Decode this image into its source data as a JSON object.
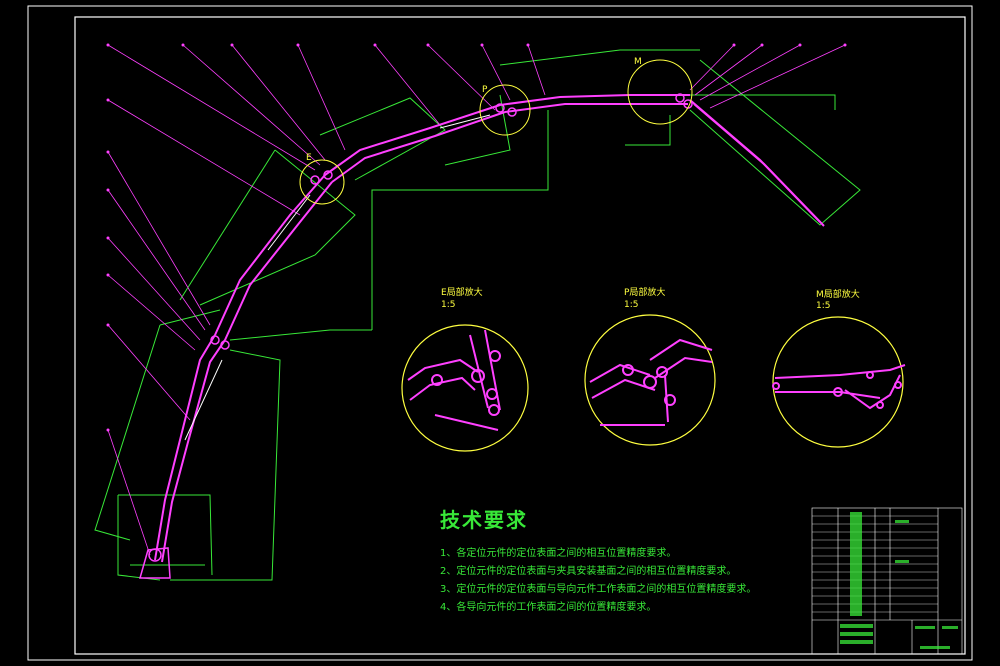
{
  "drawing": {
    "border_color": "#ffffff",
    "line_colors": {
      "frame": "#ffffff",
      "dimension": "#38e838",
      "arm": "#ff40ff",
      "detail_circle": "#ffff40",
      "leader": "#ff40ff"
    }
  },
  "detail_views": [
    {
      "letter": "E",
      "title": "E局部放大",
      "scale": "1:5"
    },
    {
      "letter": "P",
      "title": "P局部放大",
      "scale": "1:5"
    },
    {
      "letter": "M",
      "title": "M局部放大",
      "scale": "1:5"
    }
  ],
  "view_markers": {
    "e_marker": "E",
    "p_marker": "P",
    "m_marker": "M"
  },
  "tech_requirements": {
    "title": "技术要求",
    "items": [
      "1、各定位元件的定位表面之间的相互位置精度要求。",
      "2、定位元件的定位表面与夹具安装基面之间的相互位置精度要求。",
      "3、定位元件的定位表面与导向元件工作表面之间的相互位置精度要求。",
      "4、各导向元件的工作表面之间的位置精度要求。"
    ]
  }
}
